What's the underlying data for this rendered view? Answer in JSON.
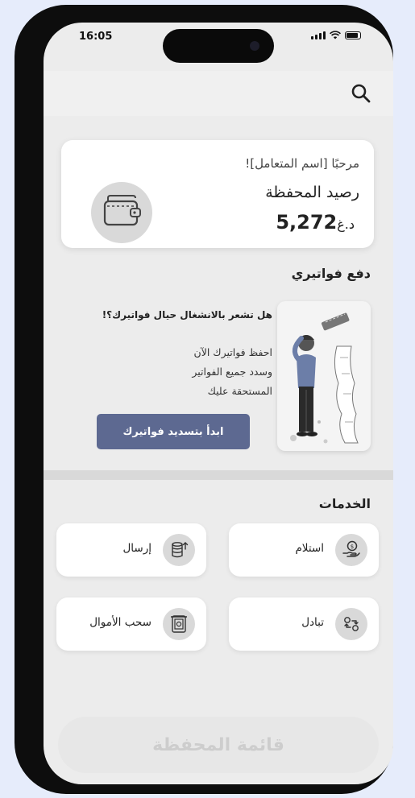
{
  "status_bar": {
    "time": "16:05"
  },
  "wallet": {
    "welcome": "مرحبًا [اسم المتعامل]!",
    "balance_label": "رصيد المحفظة",
    "balance_amount": "5,272",
    "currency": "د.غ"
  },
  "bills": {
    "section_title": "دفع فواتيري",
    "question": "هل تشعر بالانشغال حيال فواتيرك؟!",
    "line1": "احفظ فواتيرك الآن",
    "line2": "وسدد جميع الفواتير",
    "line3": "المستحقة عليك",
    "cta_label": "ابدأ بتسديد فواتيرك"
  },
  "services": {
    "section_title": "الخدمات",
    "items": [
      {
        "label": "استلام",
        "icon": "receive-money-icon"
      },
      {
        "label": "إرسال",
        "icon": "send-money-icon"
      },
      {
        "label": "تبادل",
        "icon": "exchange-icon"
      },
      {
        "label": "سحب الأموال",
        "icon": "withdraw-icon"
      }
    ]
  },
  "bottom": {
    "wallet_menu_label": "قائمة المحفظة"
  }
}
